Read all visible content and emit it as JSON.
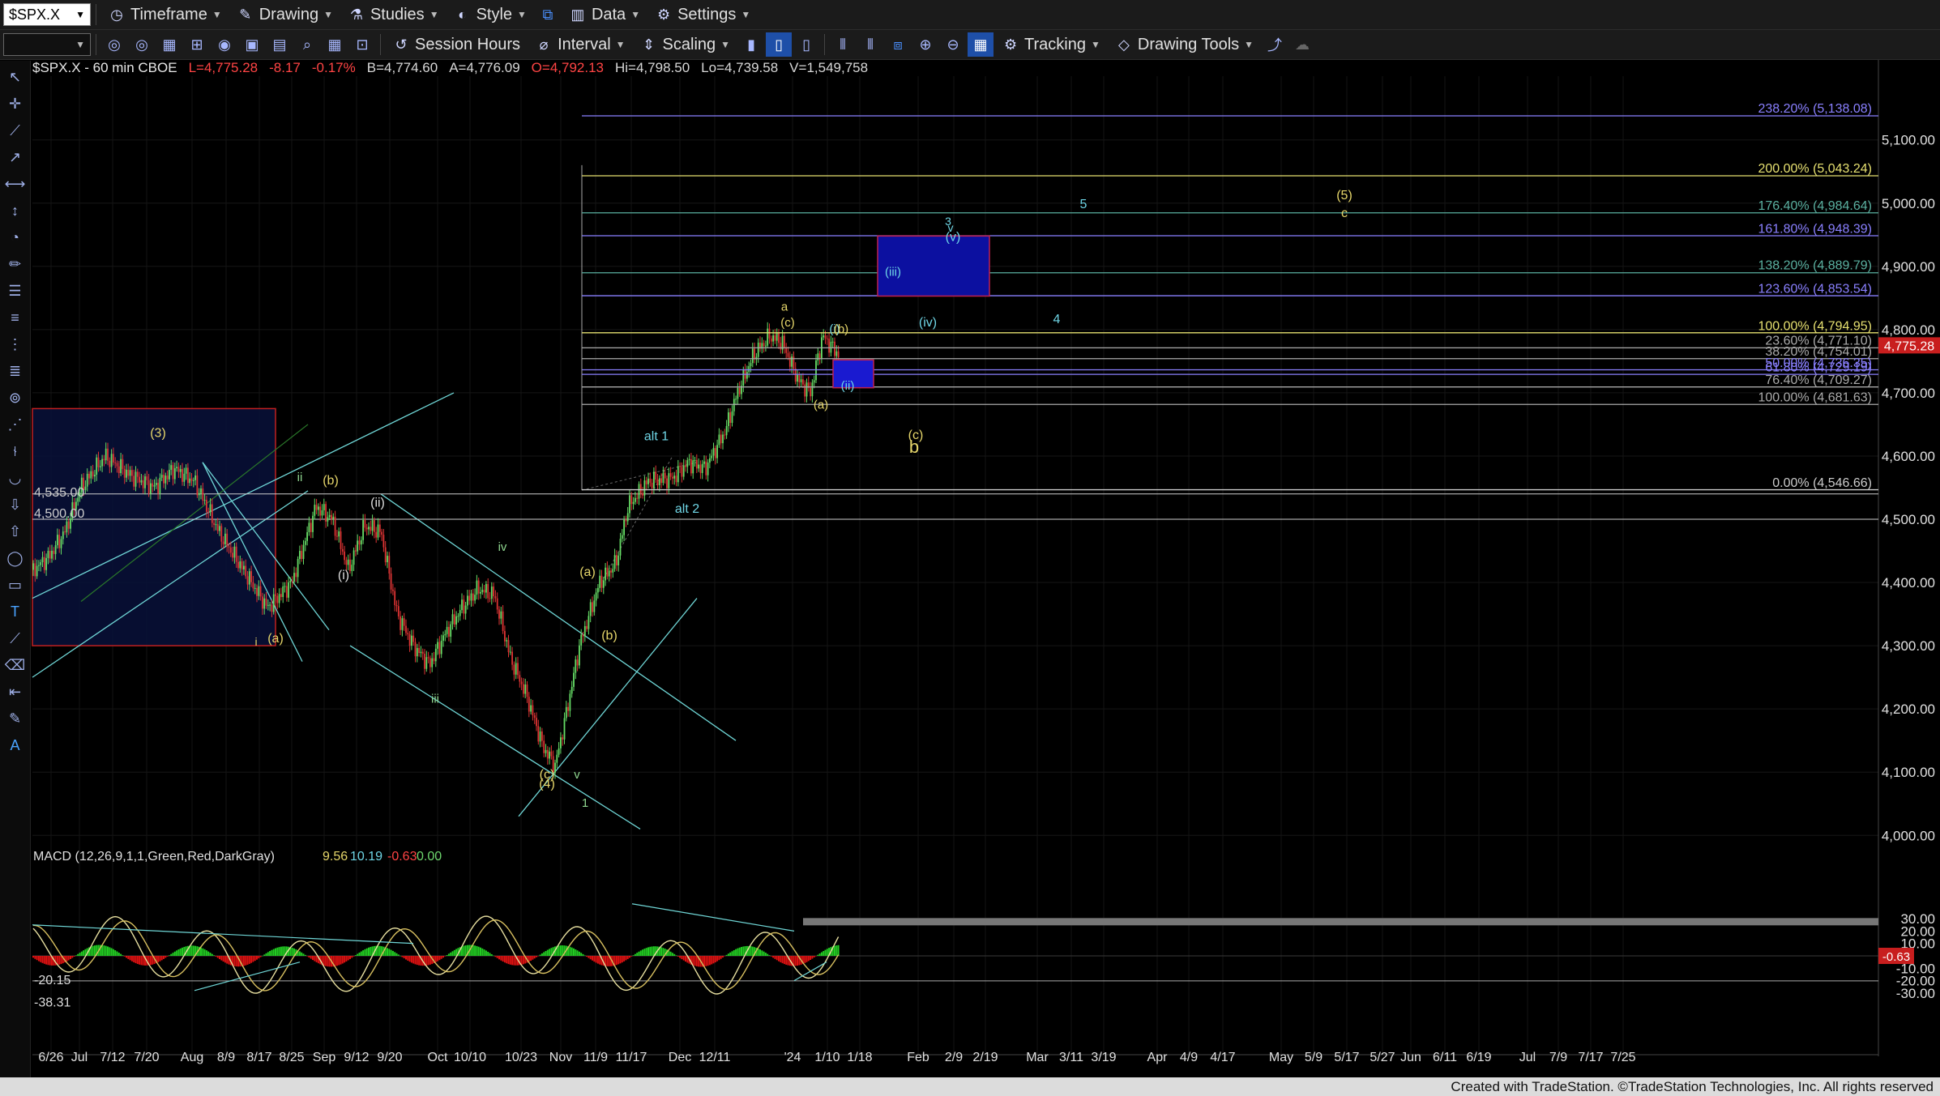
{
  "toolbar1": {
    "symbol": "$SPX.X",
    "items": [
      {
        "label": "Timeframe",
        "icon": "clock-icon"
      },
      {
        "label": "Drawing",
        "icon": "drawing-icon"
      },
      {
        "label": "Studies",
        "icon": "flask-icon"
      },
      {
        "label": "Style",
        "icon": "style-icon"
      },
      {
        "label": "Data",
        "icon": "bar-data-icon"
      },
      {
        "label": "Settings",
        "icon": "gear-icon"
      }
    ]
  },
  "toolbar2": {
    "items": [
      {
        "label": "Session Hours",
        "icon": "session-icon"
      },
      {
        "label": "Interval",
        "icon": "interval-icon"
      },
      {
        "label": "Scaling",
        "icon": "scaling-icon"
      },
      {
        "label": "Tracking",
        "icon": "tracking-icon"
      },
      {
        "label": "Drawing Tools",
        "icon": "drawing-tools-icon"
      }
    ]
  },
  "header": {
    "symbol_info": "$SPX.X - 60 min  CBOE",
    "last": "L=4,775.28",
    "change": "-8.17",
    "pct": "-0.17%",
    "bid": "B=4,774.60",
    "ask": "A=4,776.09",
    "open": "O=4,792.13",
    "high": "Hi=4,798.50",
    "low": "Lo=4,739.58",
    "volume": "V=1,549,758"
  },
  "price_axis": [
    "5,100.00",
    "5,000.00",
    "4,900.00",
    "4,800.00",
    "4,700.00",
    "4,600.00",
    "4,500.00",
    "4,400.00",
    "4,300.00",
    "4,200.00",
    "4,100.00",
    "4,000.00"
  ],
  "last_price_tag": "4,775.28",
  "macd": {
    "label": "MACD (12,26,9,1,1,Green,Red,DarkGray)",
    "v1": "9.56",
    "v2": "10.19",
    "v3": "-0.63",
    "v4": "0.00",
    "axis": [
      "30.00",
      "20.00",
      "10.00",
      "-10.00",
      "-20.00",
      "-30.00"
    ],
    "hist_tag": "-0.63",
    "left_labels": [
      "-20.15",
      "-38.31"
    ]
  },
  "time_axis": [
    "6/26",
    "Jul",
    "7/12",
    "7/20",
    "Aug",
    "8/9",
    "8/17",
    "8/25",
    "Sep",
    "9/12",
    "9/20",
    "Oct",
    "10/10",
    "10/23",
    "Nov",
    "11/9",
    "11/17",
    "Dec",
    "12/11",
    "'24",
    "1/10",
    "1/18",
    "Feb",
    "2/9",
    "2/19",
    "Mar",
    "3/11",
    "3/19",
    "Apr",
    "4/9",
    "4/17",
    "May",
    "5/9",
    "5/17",
    "5/27",
    "Jun",
    "6/11",
    "6/19",
    "Jul",
    "7/9",
    "7/17",
    "7/25"
  ],
  "fib_levels": [
    {
      "label": "238.20% (5,138.08)",
      "color": "#8a80ff"
    },
    {
      "label": "200.00% (5,043.24)",
      "color": "#e6e070"
    },
    {
      "label": "176.40% (4,984.64)",
      "color": "#5ab0a0"
    },
    {
      "label": "161.80% (4,948.39)",
      "color": "#8a80ff"
    },
    {
      "label": "138.20% (4,889.79)",
      "color": "#5ab0a0"
    },
    {
      "label": "123.60% (4,853.54)",
      "color": "#8a80ff"
    },
    {
      "label": "100.00% (4,794.95)",
      "color": "#e6e070"
    },
    {
      "label": "23.60% (4,771.10)",
      "color": "#aaa"
    },
    {
      "label": "38.20% (4,754.01)",
      "color": "#aaa"
    },
    {
      "label": "50.00% (4,736.35)",
      "color": "#8a80ff"
    },
    {
      "label": "61.80% (4,729.19)",
      "color": "#8a80ff"
    },
    {
      "label": "76.40% (4,709.27)",
      "color": "#aaa"
    },
    {
      "label": "100.00% (4,681.63)",
      "color": "#aaa"
    },
    {
      "label": "0.00% (4,546.66)",
      "color": "#ccc"
    }
  ],
  "level_labels": [
    "4,535.00",
    "4,500.00"
  ],
  "wave_labels": [
    "(3)",
    "ii",
    "(b)",
    "(ii)",
    "(i)",
    "i",
    "(a)",
    "iv",
    "iii",
    "(c)",
    "(4)",
    "v",
    "1",
    "(a)",
    "(b)",
    "alt 1",
    "alt 2",
    "a",
    "(c)",
    "(i)",
    "(b)",
    "(a)",
    "(ii)",
    "(iii)",
    "3",
    "v",
    "(v)",
    "(iv)",
    "4",
    "5",
    "(5)",
    "c",
    "(c)",
    "b"
  ],
  "footer": "Created with TradeStation. ©TradeStation Technologies, Inc. All rights reserved",
  "colors": {
    "up": "#66dd66",
    "down": "#dd3333",
    "macd_pos": "#22cc22",
    "macd_neg": "#dd1111",
    "fast": "#e8e0a0",
    "slow": "#d8c060",
    "channel": "#6fd6d6"
  }
}
